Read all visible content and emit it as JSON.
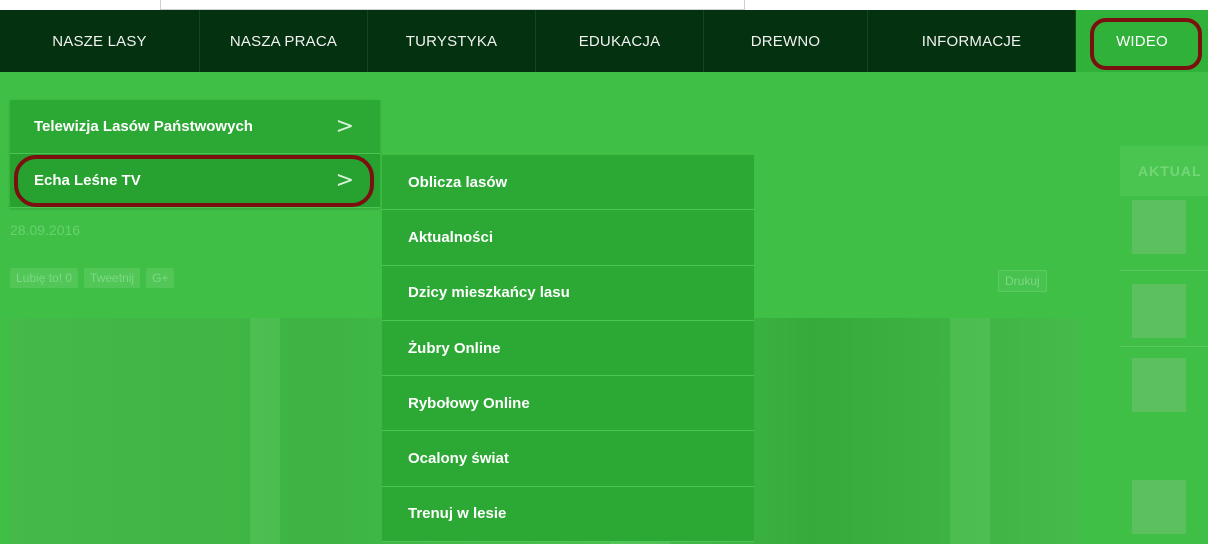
{
  "nav": {
    "items": [
      {
        "label": "NASZE LASY"
      },
      {
        "label": "NASZA PRACA"
      },
      {
        "label": "TURYSTYKA"
      },
      {
        "label": "EDUKACJA"
      },
      {
        "label": "DREWNO"
      },
      {
        "label": "INFORMACJE"
      },
      {
        "label": "WIDEO"
      }
    ]
  },
  "menu_level1": {
    "items": [
      {
        "label": "Telewizja Lasów Państwowych"
      },
      {
        "label": "Echa Leśne TV"
      }
    ],
    "chevron": ">"
  },
  "menu_level2": {
    "items": [
      {
        "label": "Oblicza lasów"
      },
      {
        "label": "Aktualności"
      },
      {
        "label": "Dzicy mieszkańcy lasu"
      },
      {
        "label": "Żubry Online"
      },
      {
        "label": "Rybołowy Online"
      },
      {
        "label": "Ocalony świat"
      },
      {
        "label": "Trenuj w lesie"
      }
    ]
  },
  "article": {
    "date": "28.09.2016",
    "like_label": "Lubię to! 0",
    "tweet_label": "Tweetnij",
    "gplus_label": "G+",
    "print_label": "Drukuj"
  },
  "sidebar": {
    "heading": "AKTUAL"
  },
  "colors": {
    "nav_bg": "#04310f",
    "active_bg": "#30b13a",
    "menu_bg": "#2ca935",
    "highlight_ring": "#7a1010"
  }
}
